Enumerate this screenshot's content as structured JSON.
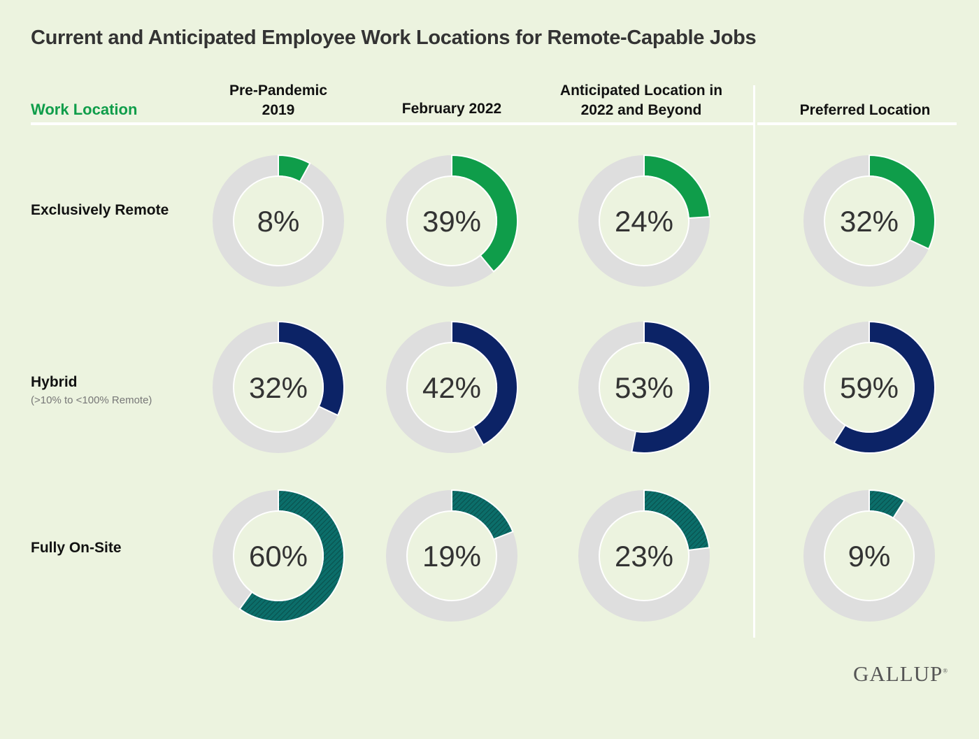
{
  "title": "Current and Anticipated Employee Work Locations for Remote-Capable Jobs",
  "row_header": "Work Location",
  "columns": [
    {
      "line1": "Pre-Pandemic",
      "line2": "2019"
    },
    {
      "line1": "",
      "line2": "February 2022"
    },
    {
      "line1": "Anticipated Location in",
      "line2": "2022 and Beyond"
    },
    {
      "line1": "",
      "line2": "Preferred Location"
    }
  ],
  "rows": [
    {
      "label": "Exclusively Remote",
      "sublabel": "",
      "color": "#0f9d4a",
      "hatched": false
    },
    {
      "label": "Hybrid",
      "sublabel": "(>10% to <100% Remote)",
      "color": "#0c2366",
      "hatched": false
    },
    {
      "label": "Fully On-Site",
      "sublabel": "",
      "color": "#0b6e6a",
      "hatched": true
    }
  ],
  "chart_data": {
    "type": "donut",
    "title": "Current and Anticipated Employee Work Locations for Remote-Capable Jobs",
    "categories": [
      "Pre-Pandemic 2019",
      "February 2022",
      "Anticipated Location in 2022 and Beyond",
      "Preferred Location"
    ],
    "series": [
      {
        "name": "Exclusively Remote",
        "values": [
          8,
          39,
          24,
          32
        ]
      },
      {
        "name": "Hybrid",
        "values": [
          32,
          42,
          53,
          59
        ]
      },
      {
        "name": "Fully On-Site",
        "values": [
          60,
          19,
          23,
          9
        ]
      }
    ],
    "unit": "%",
    "track_color": "#dedede"
  },
  "labels": [
    [
      "8%",
      "39%",
      "24%",
      "32%"
    ],
    [
      "32%",
      "42%",
      "53%",
      "59%"
    ],
    [
      "60%",
      "19%",
      "23%",
      "9%"
    ]
  ],
  "logo": "GALLUP",
  "logo_mark": "®"
}
